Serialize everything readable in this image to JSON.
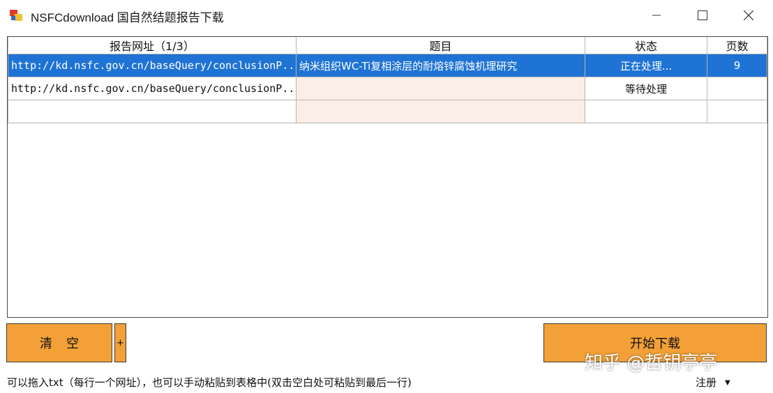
{
  "window": {
    "title": "NSFCdownload 国自然结题报告下载",
    "minimize_symbol": "—",
    "close_symbol": "✕"
  },
  "grid": {
    "columns": [
      "报告网址（1/3）",
      "题目",
      "状态",
      "页数"
    ],
    "rows": [
      {
        "url": "http://kd.nsfc.gov.cn/baseQuery/conclusionP...",
        "title": "纳米组织WC-Ti复相涂层的耐熔锌腐蚀机理研究",
        "status": "正在处理...",
        "pages": "9",
        "selected": true
      },
      {
        "url": "http://kd.nsfc.gov.cn/baseQuery/conclusionP...",
        "title": "",
        "status": "等待处理",
        "pages": "",
        "selected": false
      },
      {
        "url": "",
        "title": "",
        "status": "",
        "pages": "",
        "selected": false
      }
    ]
  },
  "buttons": {
    "clear_label": "清空",
    "plus_label": "+",
    "start_label": "开始下载"
  },
  "status_bar": {
    "hint": "可以拖入txt（每行一个网址），也可以手动粘贴到表格中(双击空白处可粘贴到最后一行)",
    "register_label": "注册",
    "register_caret": "▼"
  },
  "watermark": "知乎 @哲钥亭亭",
  "colors": {
    "accent_orange": "#f2a037",
    "selection_blue": "#1f73d4",
    "title_cell_bg": "#fbeee6"
  }
}
